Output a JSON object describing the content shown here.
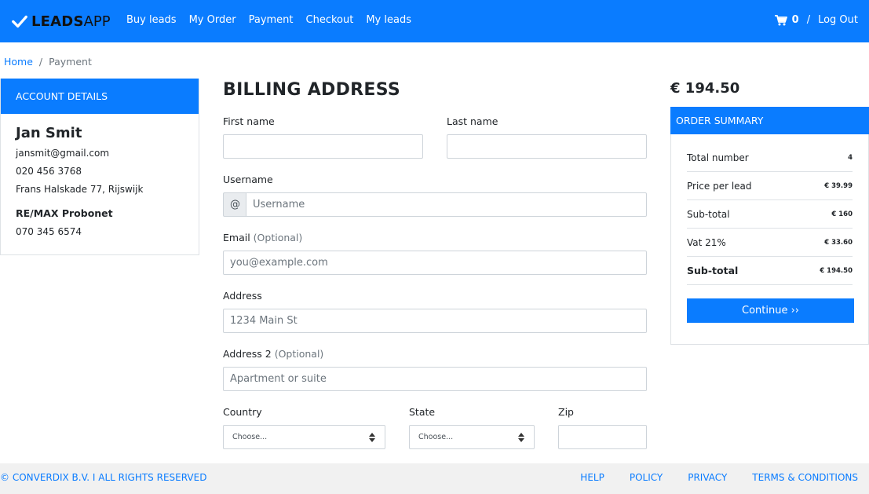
{
  "brand": {
    "bold": "LEADS",
    "light": "APP"
  },
  "nav": {
    "links": [
      "Buy leads",
      "My Order",
      "Payment",
      "Checkout",
      "My leads"
    ],
    "cart_count": "0",
    "separator": "/",
    "logout": "Log Out"
  },
  "breadcrumb": {
    "home": "Home",
    "separator": "/",
    "current": "Payment"
  },
  "account": {
    "header": "ACCOUNT DETAILS",
    "name": "Jan Smit",
    "email": "jansmit@gmail.com",
    "phone": "020 456 3768",
    "address": "Frans Halskade 77, Rijswijk",
    "company": "RE/MAX Probonet",
    "company_phone": "070 345 6574"
  },
  "billing": {
    "title": "BILLING ADDRESS",
    "first_name_label": "First name",
    "last_name_label": "Last name",
    "username_label": "Username",
    "username_addon": "@",
    "username_placeholder": "Username",
    "email_label": "Email",
    "email_optional": "(Optional)",
    "email_placeholder": "you@example.com",
    "address_label": "Address",
    "address_placeholder": "1234 Main St",
    "address2_label": "Address 2",
    "address2_optional": "(Optional)",
    "address2_placeholder": "Apartment or suite",
    "country_label": "Country",
    "country_value": "Choose...",
    "state_label": "State",
    "state_value": "Choose...",
    "zip_label": "Zip"
  },
  "summary": {
    "total_price": "€ 194.50",
    "header": "ORDER SUMMARY",
    "rows": [
      {
        "label": "Total number",
        "value": "4"
      },
      {
        "label": "Price per lead",
        "value": "€ 39.99"
      },
      {
        "label": "Sub-total",
        "value": "€ 160"
      },
      {
        "label": "Vat 21%",
        "value": "€ 33.60"
      },
      {
        "label": "Sub-total",
        "value": "€ 194.50"
      }
    ],
    "continue_label": "Continue ››"
  },
  "footer": {
    "copyright": "© CONVERDIX B.V. I ALL RIGHTS RESERVED",
    "links": [
      "HELP",
      "POLICY",
      "PRIVACY",
      "TERMS & CONDITIONS"
    ]
  },
  "colors": {
    "primary": "#0a7cff",
    "footer_bg": "#f1f1f1"
  },
  "icons": {
    "brand": "check-icon",
    "cart": "cart-icon",
    "select": "sort-arrows-icon"
  }
}
